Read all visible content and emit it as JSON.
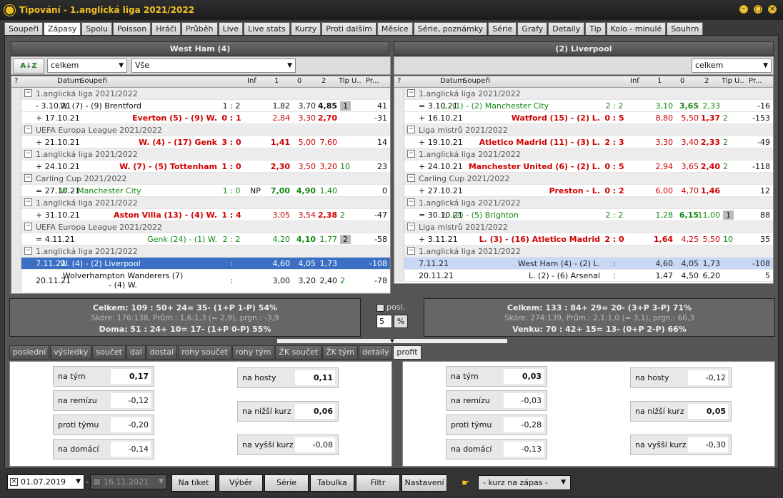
{
  "window": {
    "title": "Tipování - 1.anglická liga 2021/2022"
  },
  "main_tabs": [
    "Soupeři",
    "Zápasy",
    "Spolu",
    "Poisson",
    "Hráči",
    "Průběh",
    "Live",
    "Live stats",
    "Kurzy",
    "Proti dalším",
    "Měsíce",
    "Série, poznámky",
    "Série",
    "Grafy",
    "Detaily",
    "Tip",
    "Kolo - minulé",
    "Souhrn"
  ],
  "left": {
    "team_header": "West Ham (4)",
    "dd1": "celkem",
    "dd2": "Vše",
    "sort_label": "A↓Z",
    "headers": {
      "q": "?",
      "datum": "Datum",
      "souperi": "Soupeři",
      "inf": "Inf",
      "c1": "1",
      "c0": "0",
      "c2": "2",
      "tip": "Tip",
      "u": "U..",
      "pr": "Pr..."
    },
    "rows": [
      {
        "type": "group",
        "text": "1.anglická liga 2021/2022"
      },
      {
        "type": "match",
        "date": "- 3.10.21",
        "teams": "W. (7) - (9) Brentford",
        "score": "1 : 2",
        "inf": "",
        "o1": "1,82",
        "o0": "3,70",
        "o2": "4,85",
        "tip": "1",
        "pr": "41",
        "style": "home"
      },
      {
        "type": "match",
        "date": "+ 17.10.21",
        "teams": "Everton (5) - (9) W.",
        "score": "0 : 1",
        "inf": "",
        "o1": "2,84",
        "o0": "3,30",
        "o2": "2,70",
        "tip": "",
        "pr": "-31",
        "style": "redaway"
      },
      {
        "type": "group",
        "text": "UEFA Europa League 2021/2022"
      },
      {
        "type": "match",
        "date": "+ 21.10.21",
        "teams": "W. (4) - (17) Genk",
        "score": "3 : 0",
        "inf": "",
        "o1": "1,41",
        "o0": "5,00",
        "o2": "7,60",
        "tip": "",
        "pr": "14",
        "style": "redhome"
      },
      {
        "type": "group",
        "text": "1.anglická liga 2021/2022"
      },
      {
        "type": "match",
        "date": "+ 24.10.21",
        "teams": "W. (7) - (5) Tottenham",
        "score": "1 : 0",
        "inf": "",
        "o1": "2,30",
        "o0": "3,50",
        "o2": "3,20",
        "tip": "10",
        "pr": "23",
        "style": "redhome"
      },
      {
        "type": "group",
        "text": "Carling Cup 2021/2022"
      },
      {
        "type": "match",
        "date": "= 27.10.21",
        "teams": "W. - Manchester City",
        "score": "1 : 0",
        "inf": "NP",
        "o1": "7,00",
        "o0": "4,90",
        "o2": "1,40",
        "tip": "",
        "pr": "0",
        "style": "green"
      },
      {
        "type": "group",
        "text": "1.anglická liga 2021/2022"
      },
      {
        "type": "match",
        "date": "+ 31.10.21",
        "teams": "Aston Villa (13) - (4) W.",
        "score": "1 : 4",
        "inf": "",
        "o1": "3,05",
        "o0": "3,54",
        "o2": "2,38",
        "tip": "2",
        "pr": "-47",
        "style": "redaway"
      },
      {
        "type": "group",
        "text": "UEFA Europa League 2021/2022"
      },
      {
        "type": "match",
        "date": "= 4.11.21",
        "teams": "Genk (24) - (1) W.",
        "score": "2 : 2",
        "inf": "",
        "o1": "4,20",
        "o0": "4,10",
        "o2": "1,77",
        "tip": "2",
        "pr": "-58",
        "style": "greenaway"
      },
      {
        "type": "group",
        "text": "1.anglická liga 2021/2022"
      },
      {
        "type": "match",
        "date": "7.11.21",
        "teams": "W. (4) - (2) Liverpool",
        "score": ":",
        "inf": "",
        "o1": "4,60",
        "o0": "4,05",
        "o2": "1,73",
        "tip": "",
        "pr": "-108",
        "style": "sel"
      },
      {
        "type": "match",
        "date": "20.11.21",
        "teams": "Wolverhampton Wanderers (7) - (4) W.",
        "score": ":",
        "inf": "",
        "o1": "3,00",
        "o0": "3,20",
        "o2": "2,40",
        "tip": "2",
        "pr": "-78",
        "style": "tall"
      }
    ],
    "summary": {
      "line1": "Celkem: 109 : 50+ 24= 35- (1+P 1-P) 54%",
      "line2": "Skóre: 176:138, Prům.: 1,6:1,3 (= 2,9), prgn.: -3,9",
      "line3": "Doma: 51 : 24+ 10= 17- (1+P 0-P) 55%"
    },
    "profit": [
      {
        "label": "na tým",
        "value": "0,17",
        "bold": true
      },
      {
        "label": "na remízu",
        "value": "-0,12"
      },
      {
        "label": "proti týmu",
        "value": "-0,20"
      },
      {
        "label": "na domácí",
        "value": "-0,14"
      },
      {
        "label": "na hosty",
        "value": "0,11",
        "bold": true
      },
      {
        "label": "na nižší kurz",
        "value": "0,06",
        "bold": true
      },
      {
        "label": "na vyšší kurz",
        "value": "-0,08"
      }
    ]
  },
  "right": {
    "team_header": "(2) Liverpool",
    "dd1": "celkem",
    "headers": {
      "q": "?",
      "datum": "Datum",
      "souperi": "Soupeři",
      "inf": "Inf",
      "c1": "1",
      "c0": "0",
      "c2": "2",
      "tip": "Tip",
      "u": "U..",
      "pr": "Pr..."
    },
    "rows": [
      {
        "type": "group",
        "text": "1.anglická liga 2021/2022"
      },
      {
        "type": "match",
        "date": "= 3.10.21",
        "teams": "L. (1) - (2) Manchester City",
        "score": "2 : 2",
        "inf": "",
        "o1": "3,10",
        "o0": "3,65",
        "o2": "2,33",
        "tip": "",
        "pr": "-16",
        "style": "greenhome0"
      },
      {
        "type": "match",
        "date": "+ 16.10.21",
        "teams": "Watford (15) - (2) L.",
        "score": "0 : 5",
        "inf": "",
        "o1": "8,80",
        "o0": "5,50",
        "o2": "1,37",
        "tip": "2",
        "pr": "-153",
        "style": "redaway"
      },
      {
        "type": "group",
        "text": "Liga mistrů 2021/2022"
      },
      {
        "type": "match",
        "date": "+ 19.10.21",
        "teams": "Atletico Madrid (11) - (3) L.",
        "score": "2 : 3",
        "inf": "",
        "o1": "3,30",
        "o0": "3,40",
        "o2": "2,33",
        "tip": "2",
        "pr": "-49",
        "style": "redaway"
      },
      {
        "type": "group",
        "text": "1.anglická liga 2021/2022"
      },
      {
        "type": "match",
        "date": "+ 24.10.21",
        "teams": "Manchester United (6) - (2) L.",
        "score": "0 : 5",
        "inf": "",
        "o1": "2,94",
        "o0": "3,65",
        "o2": "2,40",
        "tip": "2",
        "pr": "-118",
        "style": "redaway"
      },
      {
        "type": "group",
        "text": "Carling Cup 2021/2022"
      },
      {
        "type": "match",
        "date": "+ 27.10.21",
        "teams": "Preston - L.",
        "score": "0 : 2",
        "inf": "",
        "o1": "6,00",
        "o0": "4,70",
        "o2": "1,46",
        "tip": "",
        "pr": "12",
        "style": "redaway"
      },
      {
        "type": "group",
        "text": "1.anglická liga 2021/2022"
      },
      {
        "type": "match",
        "date": "= 30.10.21",
        "teams": "L. (2) - (5) Brighton",
        "score": "2 : 2",
        "inf": "",
        "o1": "1,28",
        "o0": "6,15",
        "o2": "11,00",
        "tip": "1",
        "pr": "88",
        "style": "greenmid"
      },
      {
        "type": "group",
        "text": "Liga mistrů 2021/2022"
      },
      {
        "type": "match",
        "date": "+ 3.11.21",
        "teams": "L. (3) - (16) Atletico Madrid",
        "score": "2 : 0",
        "inf": "",
        "o1": "1,64",
        "o0": "4,25",
        "o2": "5,50",
        "tip": "10",
        "pr": "35",
        "style": "redhome"
      },
      {
        "type": "group",
        "text": "1.anglická liga 2021/2022"
      },
      {
        "type": "match",
        "date": "7.11.21",
        "teams": "West Ham (4) - (2) L.",
        "score": ":",
        "inf": "",
        "o1": "4,60",
        "o0": "4,05",
        "o2": "1,73",
        "tip": "",
        "pr": "-108",
        "style": "sel2"
      },
      {
        "type": "match",
        "date": "20.11.21",
        "teams": "L. (2) - (6) Arsenal",
        "score": ":",
        "inf": "",
        "o1": "1,47",
        "o0": "4,50",
        "o2": "6,20",
        "tip": "",
        "pr": "5",
        "style": "plain"
      }
    ],
    "summary": {
      "line1": "Celkem: 133 : 84+ 29= 20- (3+P 3-P) 71%",
      "line2": "Skóre: 274:139, Prům.: 2,1:1,0 (= 3,1), prgn.: 66,3",
      "line3": "Venku: 70 : 42+ 15= 13- (0+P 2-P) 66%"
    },
    "profit": [
      {
        "label": "na tým",
        "value": "0,03",
        "bold": true
      },
      {
        "label": "na remízu",
        "value": "-0,03"
      },
      {
        "label": "proti týmu",
        "value": "-0,28"
      },
      {
        "label": "na domácí",
        "value": "-0,13"
      },
      {
        "label": "na hosty",
        "value": "-0,12"
      },
      {
        "label": "na nižší kurz",
        "value": "0,05",
        "bold": true
      },
      {
        "label": "na vyšší kurz",
        "value": "-0,30"
      }
    ]
  },
  "posl": {
    "label": "posl.",
    "value": "5"
  },
  "sub_tabs": [
    "poslední",
    "výsledky",
    "součet",
    "dal",
    "dostal",
    "rohy součet",
    "rohy tým",
    "ŽK součet",
    "ŽK tým",
    "detaily",
    "profit"
  ],
  "bottom": {
    "date_from": "01.07.2019",
    "date_to": "16.11.2021",
    "separator": "-",
    "buttons": [
      "Na tiket",
      "Výběr",
      "Série",
      "Tabulka",
      "Filtr",
      "Nastavení"
    ],
    "kurz_dd": "- kurz na zápas -"
  }
}
